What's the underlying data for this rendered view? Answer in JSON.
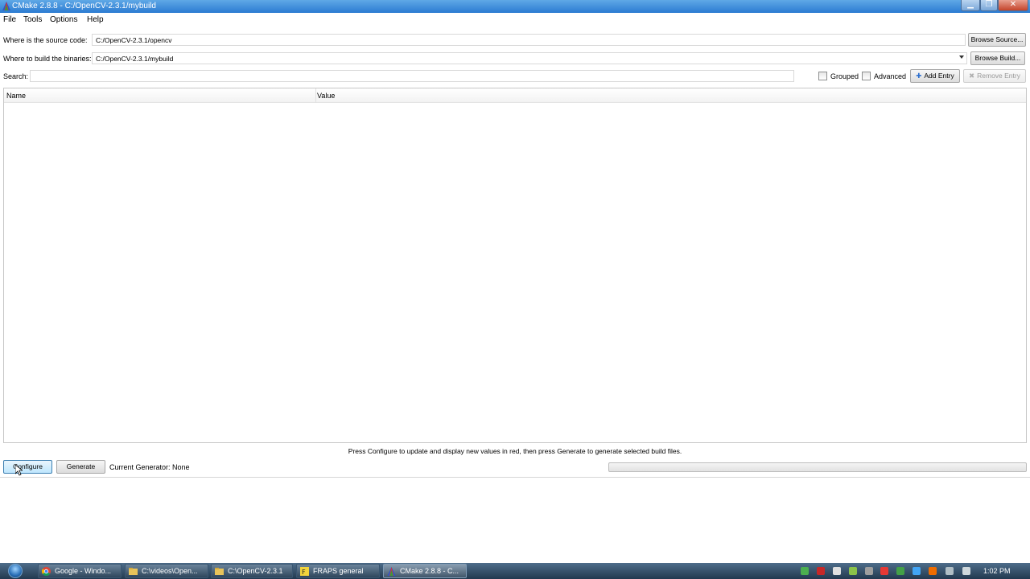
{
  "window": {
    "title": "CMake 2.8.8 - C:/OpenCV-2.3.1/mybuild"
  },
  "menu": [
    "File",
    "Tools",
    "Options",
    "Help"
  ],
  "source": {
    "label": "Where is the source code:",
    "value": "C:/OpenCV-2.3.1/opencv",
    "browse_label": "Browse Source..."
  },
  "binaries": {
    "label": "Where to build the binaries:",
    "value": "C:/OpenCV-2.3.1/mybuild",
    "browse_label": "Browse Build..."
  },
  "search": {
    "label": "Search:",
    "value": ""
  },
  "options": {
    "grouped_label": "Grouped",
    "grouped_checked": false,
    "advanced_label": "Advanced",
    "advanced_checked": false,
    "add_entry_label": "Add Entry",
    "remove_entry_label": "Remove Entry"
  },
  "table": {
    "columns": [
      "Name",
      "Value"
    ],
    "rows": []
  },
  "status_message": "Press Configure to update and display new values in red, then press Generate to generate selected build files.",
  "actions": {
    "configure_label": "Configure",
    "generate_label": "Generate",
    "generator_text": "Current Generator: None"
  },
  "progress": 0,
  "taskbar": {
    "tasks": [
      {
        "label": "Google - Windo...",
        "icon": "chrome-icon"
      },
      {
        "label": "C:\\videos\\Open...",
        "icon": "folder-icon"
      },
      {
        "label": "C:\\OpenCV-2.3.1",
        "icon": "folder-icon"
      },
      {
        "label": "FRAPS general",
        "icon": "fraps-icon"
      },
      {
        "label": "CMake 2.8.8 - C...",
        "icon": "cmake-icon"
      }
    ],
    "clock": "1:02 PM"
  },
  "colors": {
    "titlebar": "#2b7bd2",
    "taskbar": "#22394f",
    "hover_button": "#bee6fd"
  }
}
